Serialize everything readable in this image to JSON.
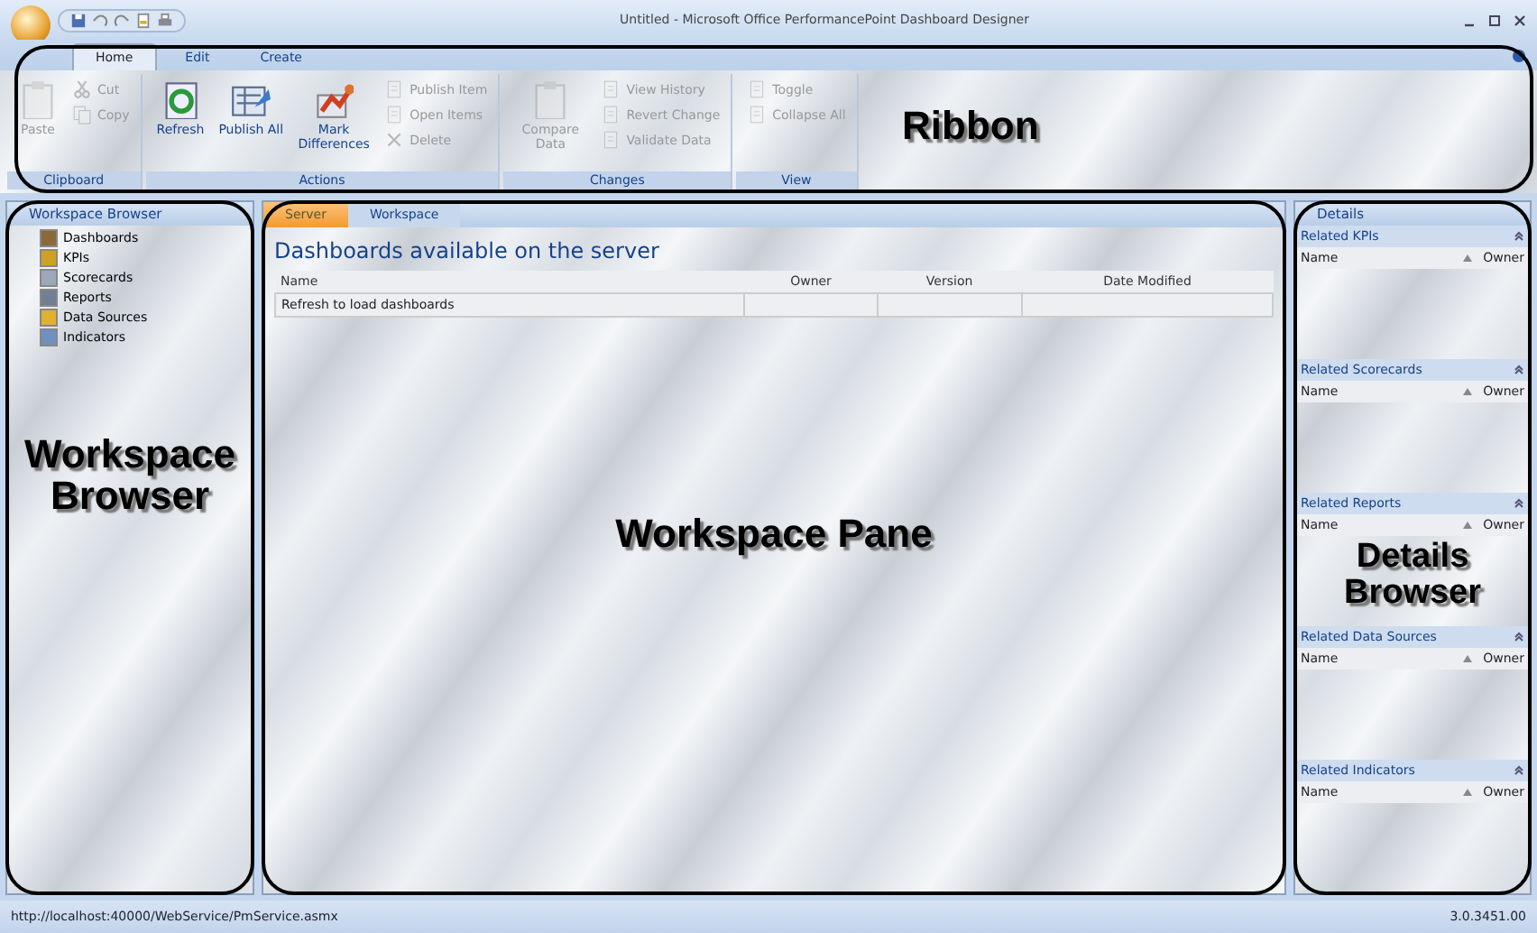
{
  "window": {
    "title": "Untitled - Microsoft Office PerformancePoint Dashboard Designer"
  },
  "ribbon": {
    "tabs": [
      {
        "label": "Home",
        "selected": true
      },
      {
        "label": "Edit",
        "selected": false
      },
      {
        "label": "Create",
        "selected": false
      }
    ],
    "groups": [
      {
        "label": "Clipboard",
        "items": [
          {
            "label": "Paste",
            "kind": "large",
            "disabled": true
          },
          {
            "kind": "stack",
            "items": [
              {
                "label": "Cut",
                "disabled": true
              },
              {
                "label": "Copy",
                "disabled": true
              }
            ]
          }
        ]
      },
      {
        "label": "Actions",
        "items": [
          {
            "label": "Refresh",
            "kind": "large",
            "disabled": false
          },
          {
            "label": "Publish All",
            "kind": "large",
            "disabled": false
          },
          {
            "label": "Mark Differences",
            "kind": "large",
            "disabled": false
          },
          {
            "kind": "stack",
            "items": [
              {
                "label": "Publish Item",
                "disabled": true
              },
              {
                "label": "Open Items",
                "disabled": true
              },
              {
                "label": "Delete",
                "disabled": true
              }
            ]
          }
        ]
      },
      {
        "label": "Changes",
        "items": [
          {
            "label": "Compare Data",
            "kind": "large",
            "disabled": true
          },
          {
            "kind": "stack",
            "items": [
              {
                "label": "View History",
                "disabled": true
              },
              {
                "label": "Revert Change",
                "disabled": true
              },
              {
                "label": "Validate Data",
                "disabled": true
              }
            ]
          }
        ]
      },
      {
        "label": "View",
        "items": [
          {
            "kind": "stack",
            "items": [
              {
                "label": "Toggle",
                "disabled": true
              },
              {
                "label": "Collapse All",
                "disabled": true
              }
            ]
          }
        ]
      }
    ],
    "annotation": "Ribbon"
  },
  "workspace_browser": {
    "title": "Workspace Browser",
    "items": [
      {
        "label": "Dashboards",
        "color": "#8a6a3a"
      },
      {
        "label": "KPIs",
        "color": "#d0a020"
      },
      {
        "label": "Scorecards",
        "color": "#9aa8b8"
      },
      {
        "label": "Reports",
        "color": "#708090"
      },
      {
        "label": "Data Sources",
        "color": "#e0b030"
      },
      {
        "label": "Indicators",
        "color": "#7090c0"
      }
    ],
    "annotation": "Workspace Browser"
  },
  "workspace_pane": {
    "tabs": [
      {
        "label": "Server",
        "selected": true
      },
      {
        "label": "Workspace",
        "selected": false
      }
    ],
    "heading": "Dashboards available on the server",
    "table": {
      "columns": [
        "Name",
        "Owner",
        "Version",
        "Date Modified"
      ],
      "rows": [
        [
          "Refresh to load dashboards",
          "",
          "",
          ""
        ]
      ]
    },
    "annotation": "Workspace Pane"
  },
  "details": {
    "title": "Details",
    "sections": [
      {
        "title": "Related KPIs",
        "columns": [
          "Name",
          "Owner"
        ]
      },
      {
        "title": "Related Scorecards",
        "columns": [
          "Name",
          "Owner"
        ]
      },
      {
        "title": "Related Reports",
        "columns": [
          "Name",
          "Owner"
        ]
      },
      {
        "title": "Related Data Sources",
        "columns": [
          "Name",
          "Owner"
        ]
      },
      {
        "title": "Related Indicators",
        "columns": [
          "Name",
          "Owner"
        ]
      }
    ],
    "annotation": "Details Browser"
  },
  "status_bar": {
    "url": "http://localhost:40000/WebService/PmService.asmx",
    "version": "3.0.3451.00"
  }
}
